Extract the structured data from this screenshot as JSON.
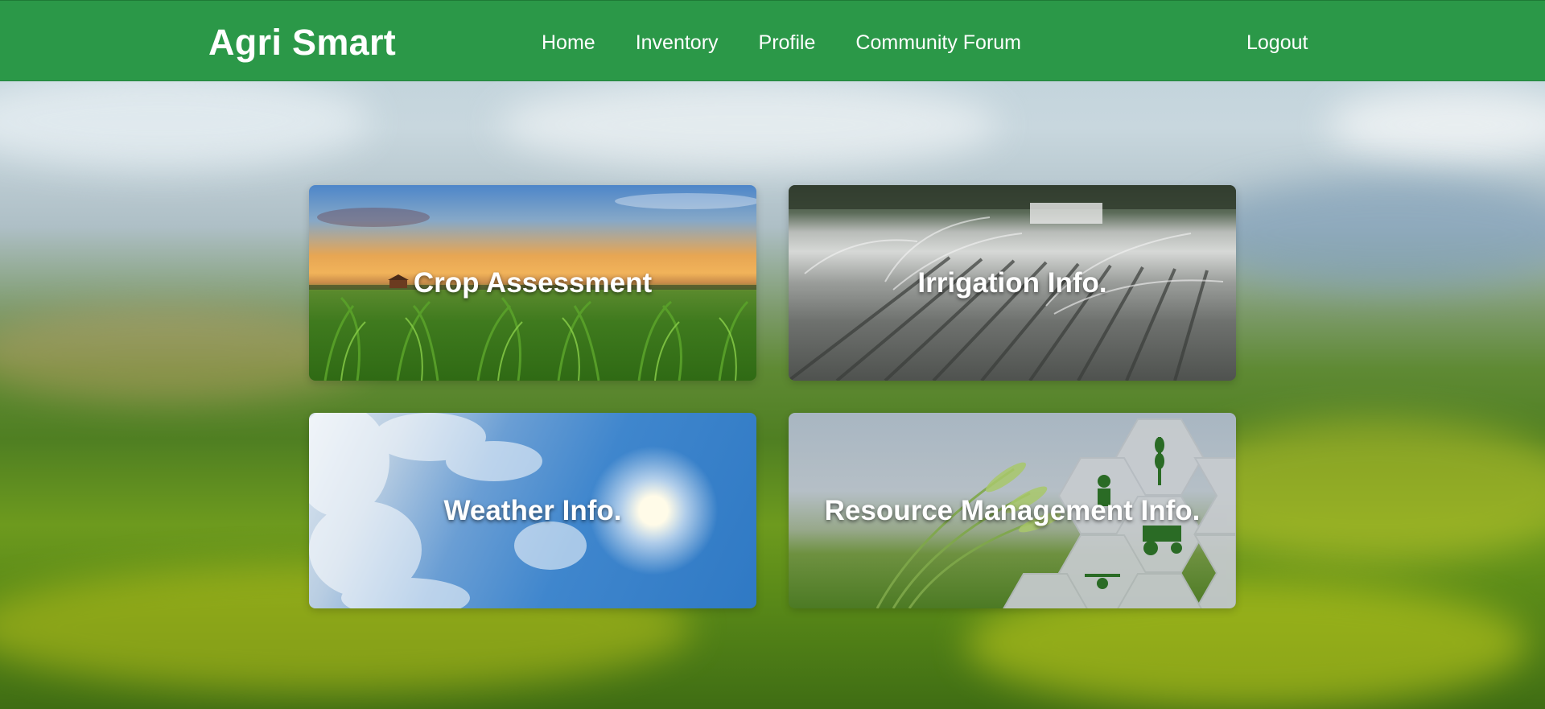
{
  "header": {
    "brand": "Agri Smart",
    "nav": [
      "Home",
      "Inventory",
      "Profile",
      "Community Forum"
    ],
    "logout": "Logout"
  },
  "tiles": [
    {
      "label": "Crop Assessment"
    },
    {
      "label": "Irrigation Info."
    },
    {
      "label": "Weather Info."
    },
    {
      "label": "Resource Management Info."
    }
  ],
  "colors": {
    "header_bg": "#2b9848",
    "text": "#ffffff",
    "icon_green": "#2a6b25"
  }
}
